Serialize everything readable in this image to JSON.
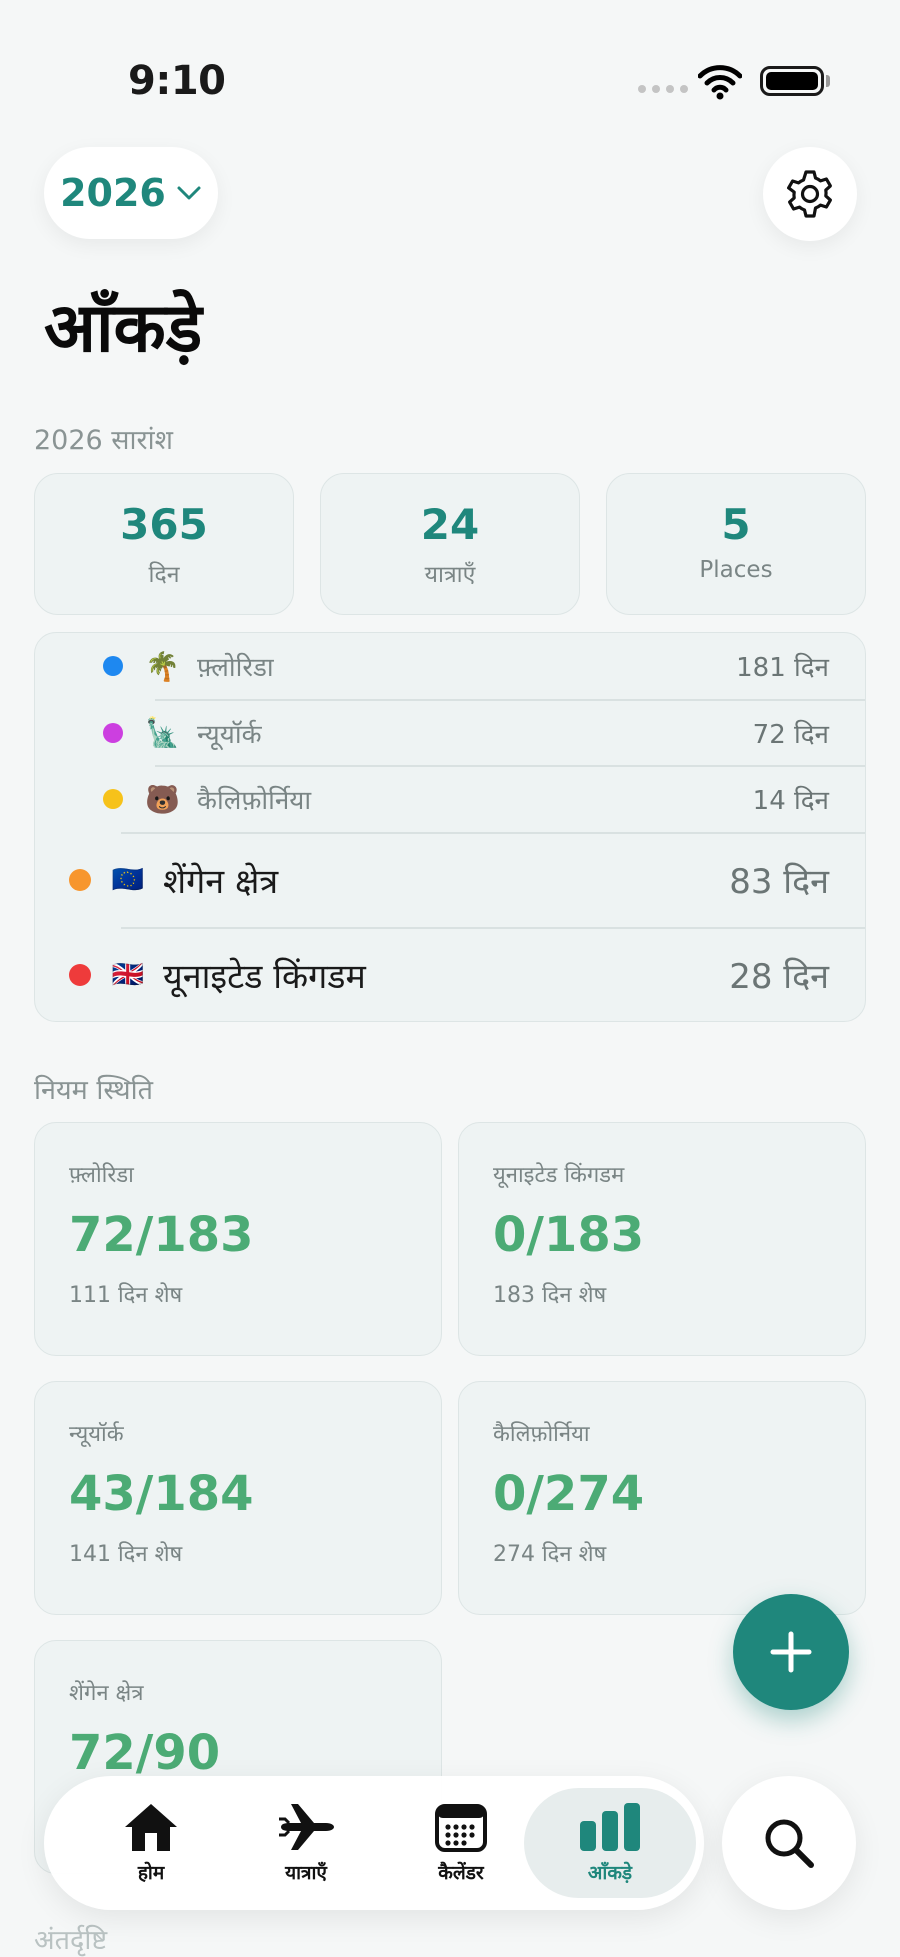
{
  "status_bar": {
    "time": "9:10"
  },
  "header": {
    "year": "2026",
    "title": "आँकड़े"
  },
  "summary": {
    "label": "2026 सारांश",
    "cards": [
      {
        "value": "365",
        "label": "दिन"
      },
      {
        "value": "24",
        "label": "यात्राएँ"
      },
      {
        "value": "5",
        "label": "Places"
      }
    ]
  },
  "places": [
    {
      "name": "फ़्लोरिडा",
      "emoji": "🌴",
      "days": "181 दिन",
      "color": "#1e88f0"
    },
    {
      "name": "न्यूयॉर्क",
      "emoji": "🗽",
      "days": "72 दिन",
      "color": "#cc3fe0"
    },
    {
      "name": "कैलिफ़ोर्निया",
      "emoji": "🐻",
      "days": "14 दिन",
      "color": "#f6c21a"
    },
    {
      "name": "शेंगेन क्षेत्र",
      "emoji": "🇪🇺",
      "days": "83 दिन",
      "color": "#f7962e"
    },
    {
      "name": "यूनाइटेड किंगडम",
      "emoji": "🇬🇧",
      "days": "28 दिन",
      "color": "#ee3b3b"
    }
  ],
  "rules": {
    "label": "नियम स्थिति",
    "cards": [
      {
        "name": "फ़्लोरिडा",
        "value": "72/183",
        "remaining": "111 दिन शेष"
      },
      {
        "name": "यूनाइटेड किंगडम",
        "value": "0/183",
        "remaining": "183 दिन शेष"
      },
      {
        "name": "न्यूयॉर्क",
        "value": "43/184",
        "remaining": "141 दिन शेष"
      },
      {
        "name": "कैलिफ़ोर्निया",
        "value": "0/274",
        "remaining": "274 दिन शेष"
      },
      {
        "name": "शेंगेन क्षेत्र",
        "value": "72/90",
        "remaining": ""
      }
    ]
  },
  "insights_label": "अंतर्दृष्टि",
  "tabbar": {
    "tabs": [
      {
        "label": "होम",
        "icon": "home-icon"
      },
      {
        "label": "यात्राएँ",
        "icon": "airplane-icon"
      },
      {
        "label": "कैलेंडर",
        "icon": "calendar-icon"
      },
      {
        "label": "आँकड़े",
        "icon": "bar-chart-icon",
        "active": true
      }
    ]
  },
  "colors": {
    "accent": "#1f877c",
    "rule_value": "#4cab75"
  }
}
